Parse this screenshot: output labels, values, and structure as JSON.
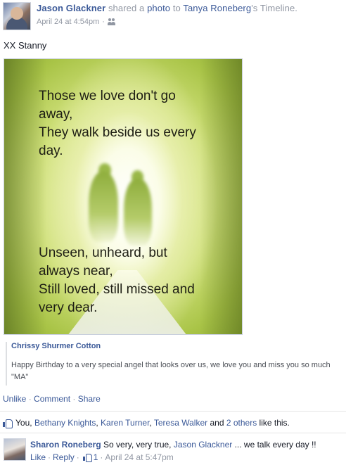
{
  "post": {
    "actor": "Jason Glackner",
    "verb": "shared a",
    "object_link": "photo",
    "to_text": "to",
    "target": "Tanya Roneberg",
    "possessive": "'s Timeline.",
    "timestamp": "April 24 at 4:54pm",
    "separator": "·",
    "audience_icon": "friends-icon",
    "message": "XX Stanny"
  },
  "photo": {
    "quote_top": "Those we love don't go\naway,\nThey walk beside us every\nday.",
    "quote_bottom": "Unseen, unheard, but\nalways near,\nStill loved, still missed and\nvery dear."
  },
  "shared_caption": {
    "author": "Chrissy Shurmer Cotton",
    "text": "Happy Birthday to a very special angel that looks over us, we love you and miss you so much \"MA\""
  },
  "actions": {
    "like": "Unlike",
    "comment": "Comment",
    "share": "Share",
    "separator": "·"
  },
  "likes": {
    "icon": "thumb-up-icon",
    "you": "You,",
    "names": [
      "Bethany Knights",
      "Karen Turner",
      "Teresa Walker"
    ],
    "comma": ",",
    "and": "and",
    "others": "2 others",
    "suffix": "like this."
  },
  "comment": {
    "author": "Sharon Roneberg",
    "text_before": "So very, very true,",
    "mention": "Jason Glackner",
    "text_after": "... we talk every day !!",
    "like": "Like",
    "reply": "Reply",
    "like_count": "1",
    "timestamp": "April 24 at 5:47pm",
    "separator": "·"
  },
  "colors": {
    "link": "#3b5998",
    "muted": "#9197a3",
    "text": "#141823"
  }
}
